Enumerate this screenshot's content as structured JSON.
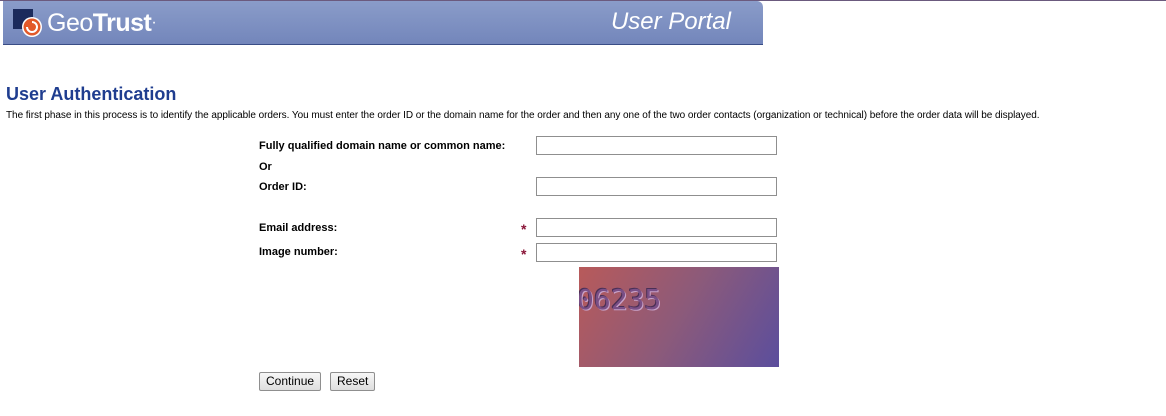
{
  "header": {
    "brand": {
      "part1": "Geo",
      "part2": "Trust",
      "mark": "·"
    },
    "portal_title": "User Portal"
  },
  "page": {
    "title": "User Authentication",
    "intro": "The first phase in this process is to identify the applicable orders. You must enter the order ID or the domain name for the order and then any one of the two order contacts (organization or technical) before the order data will be displayed."
  },
  "form": {
    "domain_label": "Fully qualified domain name or common name:",
    "or_label": "Or",
    "order_id_label": "Order ID:",
    "email_label": "Email address:",
    "image_number_label": "Image number:",
    "required_mark": "*",
    "domain_value": "",
    "order_id_value": "",
    "email_value": "",
    "image_number_value": "",
    "captcha_text": "06235",
    "continue_label": "Continue",
    "reset_label": "Reset"
  },
  "colors": {
    "banner": "#7a8cc1",
    "title": "#1f3d8f",
    "required": "#8a1538",
    "logo_orange": "#e2592a"
  },
  "icons": {
    "logo": "geotrust-logo-icon"
  }
}
